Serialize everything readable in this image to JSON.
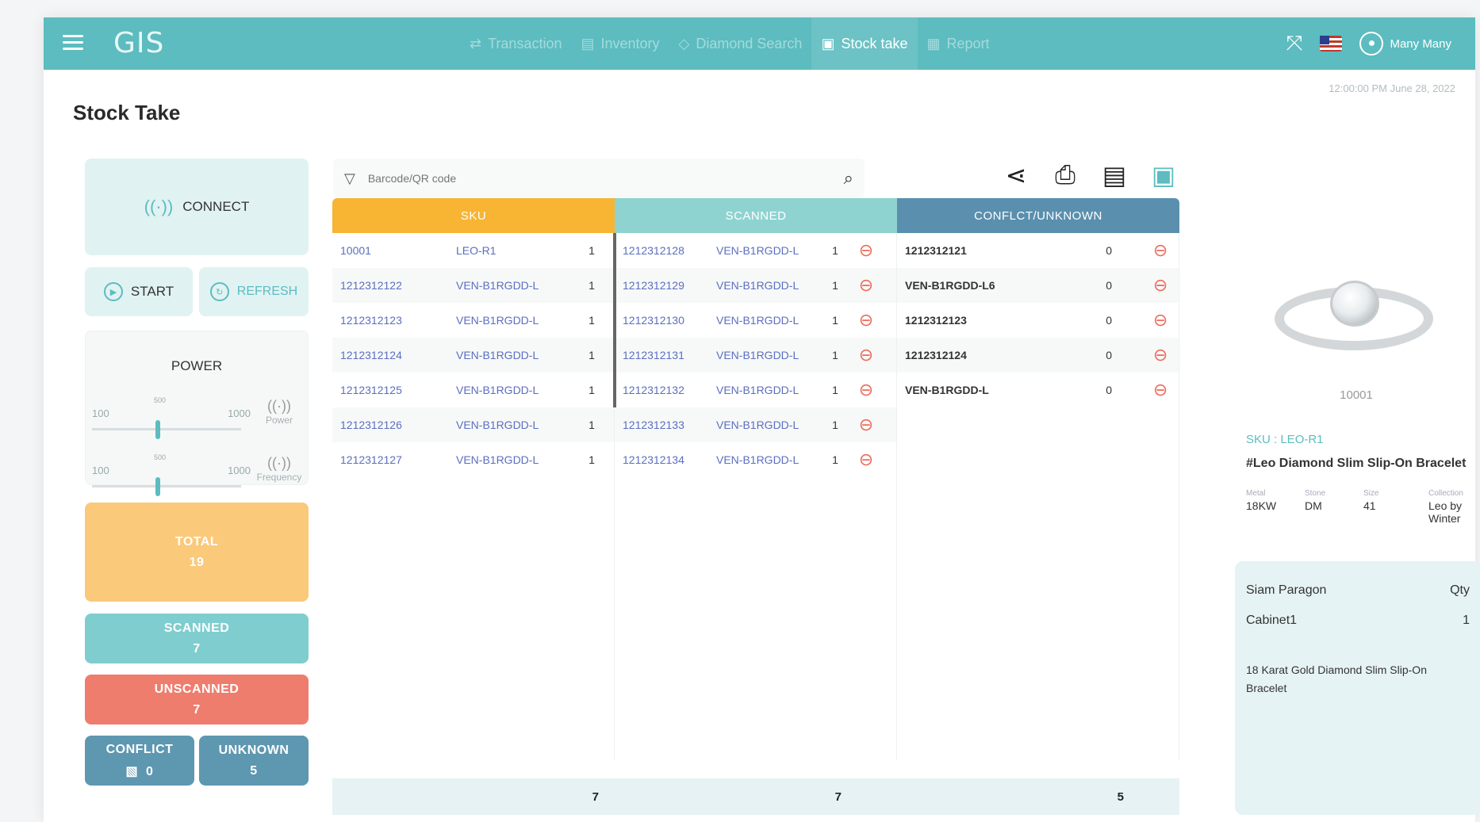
{
  "app": {
    "logo": "GIS",
    "nav": [
      {
        "label": "Transaction",
        "icon": "⇄"
      },
      {
        "label": "Inventory",
        "icon": "▤"
      },
      {
        "label": "Diamond Search",
        "icon": "◇"
      },
      {
        "label": "Stock take",
        "icon": "▣"
      },
      {
        "label": "Report",
        "icon": "▦"
      }
    ],
    "user": "Many Many",
    "datetime": "12:00:00 PM June 28, 2022"
  },
  "page": {
    "title": "Stock Take"
  },
  "left": {
    "connect_label": "CONNECT",
    "start_label": "START",
    "refresh_label": "REFRESH",
    "power_title": "POWER",
    "power_slider": {
      "min": "100",
      "max": "1000",
      "current_label": "500",
      "label": "Power",
      "value": 500
    },
    "frequency_slider": {
      "min": "100",
      "max": "1000",
      "current_label": "500",
      "label": "Frequency",
      "value": 500
    },
    "total": {
      "label": "TOTAL",
      "value": "19"
    },
    "scanned": {
      "label": "SCANNED",
      "value": "7"
    },
    "unscanned": {
      "label": "UNSCANNED",
      "value": "7"
    },
    "conflict": {
      "label": "CONFLICT",
      "value": "0"
    },
    "unknown": {
      "label": "UNKNOWN",
      "value": "5"
    }
  },
  "search": {
    "placeholder": "Barcode/QR code"
  },
  "table": {
    "headers": {
      "sku": "SKU",
      "scanned": "SCANNED",
      "conflict": "CONFLCT/UNKNOWN"
    },
    "sku_rows": [
      {
        "code": "10001",
        "sku": "LEO-R1",
        "qty": "1"
      },
      {
        "code": "1212312122",
        "sku": "VEN-B1RGDD-L",
        "qty": "1"
      },
      {
        "code": "1212312123",
        "sku": "VEN-B1RGDD-L",
        "qty": "1"
      },
      {
        "code": "1212312124",
        "sku": "VEN-B1RGDD-L",
        "qty": "1"
      },
      {
        "code": "1212312125",
        "sku": "VEN-B1RGDD-L",
        "qty": "1"
      },
      {
        "code": "1212312126",
        "sku": "VEN-B1RGDD-L",
        "qty": "1"
      },
      {
        "code": "1212312127",
        "sku": "VEN-B1RGDD-L",
        "qty": "1"
      }
    ],
    "scanned_rows": [
      {
        "code": "1212312128",
        "sku": "VEN-B1RGDD-L",
        "qty": "1"
      },
      {
        "code": "1212312129",
        "sku": "VEN-B1RGDD-L",
        "qty": "1"
      },
      {
        "code": "1212312130",
        "sku": "VEN-B1RGDD-L",
        "qty": "1"
      },
      {
        "code": "1212312131",
        "sku": "VEN-B1RGDD-L",
        "qty": "1"
      },
      {
        "code": "1212312132",
        "sku": "VEN-B1RGDD-L",
        "qty": "1"
      },
      {
        "code": "1212312133",
        "sku": "VEN-B1RGDD-L",
        "qty": "1"
      },
      {
        "code": "1212312134",
        "sku": "VEN-B1RGDD-L",
        "qty": "1"
      }
    ],
    "conflict_rows": [
      {
        "code": "1212312121",
        "qty": "0"
      },
      {
        "code": "VEN-B1RGDD-L6",
        "qty": "0"
      },
      {
        "code": "1212312123",
        "qty": "0"
      },
      {
        "code": "1212312124",
        "qty": "0"
      },
      {
        "code": "VEN-B1RGDD-L",
        "qty": "0"
      }
    ],
    "footer": {
      "sku_total": "7",
      "scanned_total": "7",
      "conflict_total": "5"
    }
  },
  "product": {
    "code": "10001",
    "sku_label": "SKU : LEO-R1",
    "name": "#Leo Diamond Slim Slip-On Bracelet",
    "attrs": [
      {
        "key": "Metal",
        "value": "18KW"
      },
      {
        "key": "Stone",
        "value": "DM"
      },
      {
        "key": "Size",
        "value": "41"
      },
      {
        "key": "Collection",
        "value": "Leo by Winter"
      }
    ]
  },
  "location": {
    "store": "Siam Paragon",
    "qty_header": "Qty",
    "cabinet": "Cabinet1",
    "qty": "1",
    "description": "18 Karat Gold Diamond Slim Slip-On Bracelet"
  },
  "colors": {
    "primary": "#5cbcbf",
    "sku_header": "#f7b533",
    "scanned_header": "#8fd3d1",
    "conflict_header": "#5a8fae",
    "total": "#fbc97a",
    "unscanned": "#ee7d6e",
    "remove": "#ee6b5b"
  }
}
